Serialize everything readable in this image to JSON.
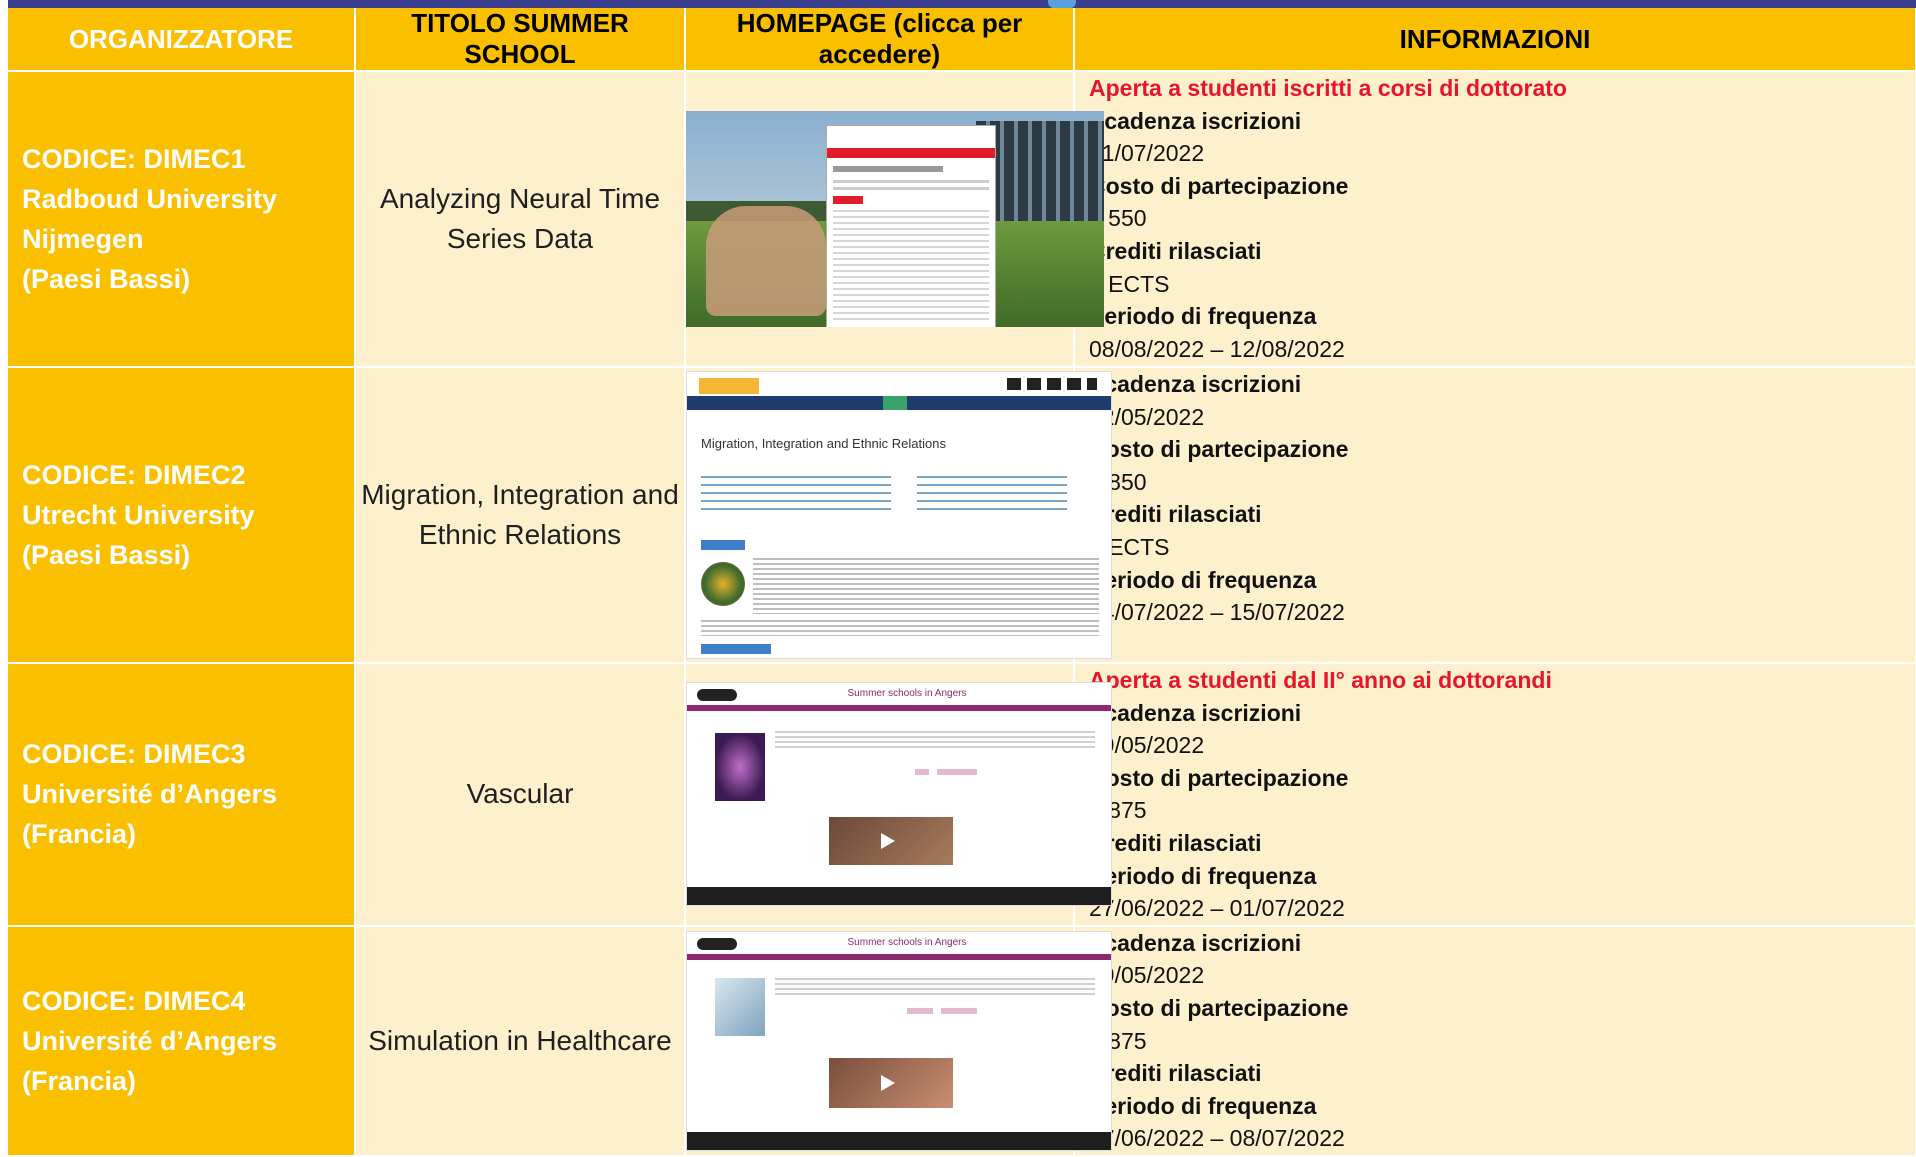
{
  "headers": {
    "organizer": "ORGANIZZATORE",
    "title": "TITOLO SUMMER SCHOOL",
    "homepage": "HOMEPAGE (clicca per accedere)",
    "info": "INFORMAZIONI"
  },
  "rows": [
    {
      "code": "CODICE: DIMEC1",
      "org_line1": "Radboud University Nijmegen",
      "org_line2": "(Paesi Bassi)",
      "title_line1": "Analyzing Neural Time",
      "title_line2": "Series Data",
      "thumb_icon": "radboud-homepage-screenshot",
      "note": "Aperta a studenti iscritti a corsi di dottorato",
      "deadline_label": "Scadenza iscrizioni",
      "deadline": "01/07/2022",
      "cost_label": "Costo di partecipazione",
      "cost": "€ 550",
      "credits_label": "Crediti rilasciati",
      "credits": "2 ECTS",
      "period_label": "Periodo di frequenza",
      "period": "08/08/2022 – 12/08/2022"
    },
    {
      "code": "CODICE: DIMEC2",
      "org_line1": "Utrecht University",
      "org_line2": "(Paesi Bassi)",
      "title_line1": "Migration, Integration and",
      "title_line2": "Ethnic Relations",
      "thumb_icon": "utrecht-homepage-screenshot",
      "thumb_heading": "Migration, Integration and Ethnic Relations",
      "deadline_label": "Scadenza iscrizioni",
      "deadline": "02/05/2022",
      "cost_label": "Costo di partecipazione",
      "cost": "€ 850",
      "credits_label": "Crediti rilasciati",
      "credits": "3 ECTS",
      "period_label": "Periodo di frequenza",
      "period": "04/07/2022 – 15/07/2022"
    },
    {
      "code": "CODICE: DIMEC3",
      "org_line1": "Université d’Angers (Francia)",
      "title_line1": "Vascular",
      "thumb_icon": "angers-homepage-screenshot",
      "thumb_heading": "Summer schools in Angers",
      "note": "Aperta a studenti dal II° anno ai dottorandi",
      "deadline_label": "Scadenza iscrizioni",
      "deadline": "09/05/2022",
      "cost_label": "Costo di partecipazione",
      "cost": "€ 875",
      "credits_label": "Crediti rilasciati",
      "period_label": "Periodo di frequenza",
      "period": "27/06/2022 – 01/07/2022"
    },
    {
      "code": "CODICE: DIMEC4",
      "org_line1": "Université d’Angers (Francia)",
      "title_line1": "Simulation in Healthcare",
      "thumb_icon": "angers-homepage-screenshot",
      "thumb_heading": "Summer schools in Angers",
      "deadline_label": "Scadenza iscrizioni",
      "deadline": "09/05/2022",
      "cost_label": "Costo di partecipazione",
      "cost": "€ 875",
      "credits_label": "Crediti rilasciati",
      "period_label": "Periodo di frequenza",
      "period": "27/06/2022 – 08/07/2022"
    }
  ],
  "colors": {
    "header_bg": "#fac000",
    "organizer_bg": "#fac000",
    "cell_bg": "#fdf0cc",
    "note_red": "#e8142a",
    "top_strip": "#3b3f8f"
  }
}
